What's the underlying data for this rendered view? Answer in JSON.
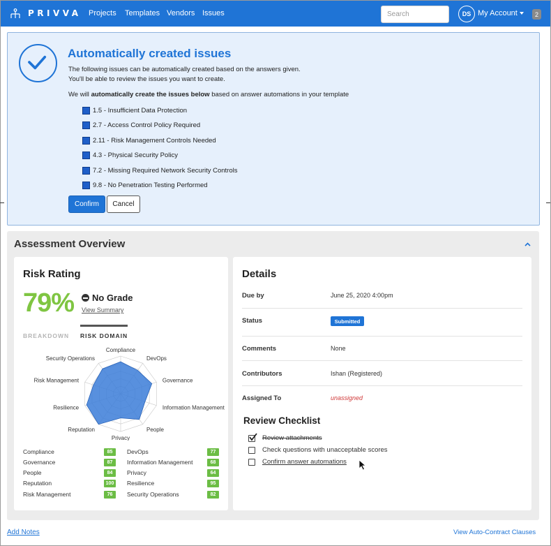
{
  "nav": {
    "brand": "PRIVVA",
    "links": [
      "Projects",
      "Templates",
      "Vendors",
      "Issues"
    ],
    "search_placeholder": "Search",
    "avatar_initials": "DS",
    "account_label": "My Account",
    "notification_count": "2"
  },
  "alert": {
    "title": "Automatically created issues",
    "line1": "The following issues can be automatically created based on the answers given.",
    "line2": "You'll be able to review the issues you want to create.",
    "line3_pre": "We will ",
    "line3_bold": "automatically create the issues below",
    "line3_post": " based on answer automations in your template",
    "issues": [
      "1.5 - Insufficient Data Protection",
      "2.7 - Access Control Policy Required",
      "2.11 - Risk Management Controls Needed",
      "4.3 - Physical Security Policy",
      "7.2 - Missing Required Network Security Controls",
      "9.8 - No Penetration Testing Performed"
    ],
    "confirm_label": "Confirm",
    "cancel_label": "Cancel"
  },
  "overview": {
    "title": "Assessment Overview",
    "risk": {
      "title": "Risk Rating",
      "percent": "79%",
      "grade": "No Grade",
      "view_summary": "View Summary",
      "tab_breakdown": "BREAKDOWN",
      "tab_risk_domain": "RISK DOMAIN",
      "radar_labels": [
        "Compliance",
        "DevOps",
        "Governance",
        "Information Management",
        "People",
        "Privacy",
        "Reputation",
        "Resilience",
        "Risk Management",
        "Security Operations"
      ],
      "scores_left": [
        {
          "name": "Compliance",
          "score": "85",
          "value": 85
        },
        {
          "name": "Governance",
          "score": "87",
          "value": 87
        },
        {
          "name": "People",
          "score": "84",
          "value": 84
        },
        {
          "name": "Reputation",
          "score": "100",
          "value": 100
        },
        {
          "name": "Risk Management",
          "score": "76",
          "value": 76
        }
      ],
      "scores_right": [
        {
          "name": "DevOps",
          "score": "77",
          "value": 77
        },
        {
          "name": "Information Management",
          "score": "68",
          "value": 68
        },
        {
          "name": "Privacy",
          "score": "64",
          "value": 64
        },
        {
          "name": "Resilience",
          "score": "95",
          "value": 95
        },
        {
          "name": "Security Operations",
          "score": "82",
          "value": 82
        }
      ],
      "badge_color": "#6cbd45",
      "radar_fill": "#3b7dd8"
    },
    "details": {
      "title": "Details",
      "due_label": "Due by",
      "due_value": "June 25, 2020 4:00pm",
      "status_label": "Status",
      "status_value": "Submitted",
      "comments_label": "Comments",
      "comments_value": "None",
      "contributors_label": "Contributors",
      "contributors_value": "Ishan (Registered)",
      "assigned_label": "Assigned To",
      "assigned_value": "unassigned"
    },
    "checklist": {
      "title": "Review Checklist",
      "items": [
        {
          "label": "Review attachments",
          "checked": true
        },
        {
          "label": "Check questions with unacceptable scores",
          "checked": false
        },
        {
          "label": "Confirm answer automations",
          "checked": false
        }
      ]
    }
  },
  "footer": {
    "add_notes": "Add Notes",
    "auto_contract": "View Auto-Contract Clauses"
  }
}
